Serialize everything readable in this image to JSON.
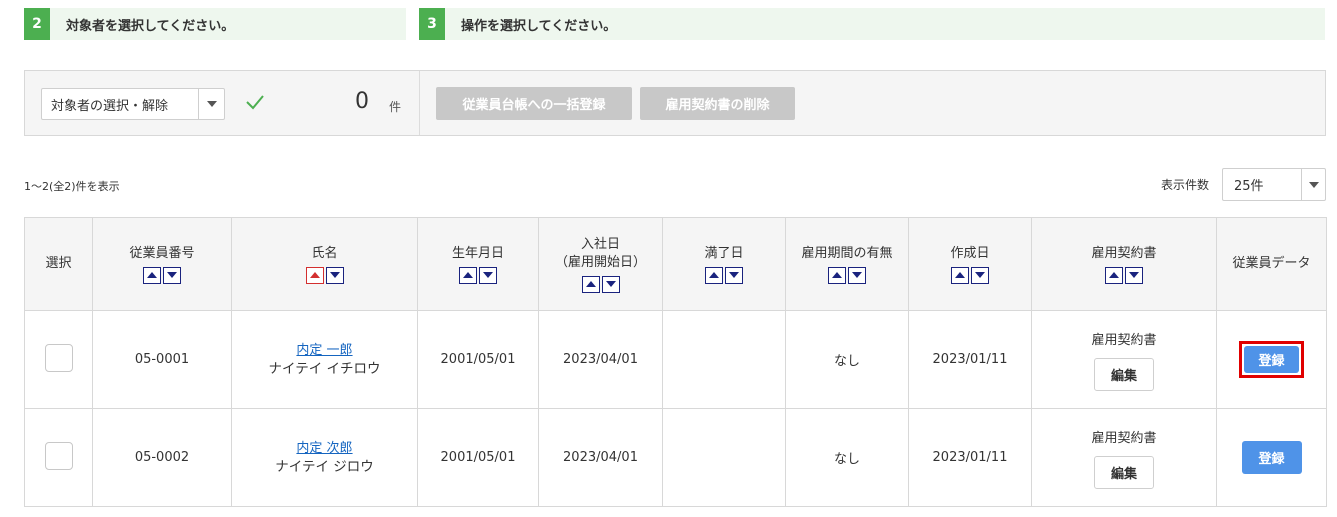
{
  "steps": [
    {
      "number": "2",
      "label": "対象者を選択してください。"
    },
    {
      "number": "3",
      "label": "操作を選択してください。"
    }
  ],
  "actions": {
    "target_select_label": "対象者の選択・解除",
    "selected_count": "0",
    "count_unit": "件",
    "bulk_register_label": "従業員台帳への一括登録",
    "delete_contract_label": "雇用契約書の削除"
  },
  "results": {
    "summary": "1〜2(全2)件を表示",
    "per_page_label": "表示件数",
    "per_page_value": "25件"
  },
  "table": {
    "headers": {
      "select": "選択",
      "employee_no": "従業員番号",
      "name": "氏名",
      "birthdate": "生年月日",
      "hire_date_1": "入社日",
      "hire_date_2": "（雇用開始日）",
      "end_date": "満了日",
      "term": "雇用期間の有無",
      "created": "作成日",
      "contract": "雇用契約書",
      "employee_data": "従業員データ"
    },
    "rows": [
      {
        "employee_no": "05-0001",
        "name": "内定 一郎",
        "kana": "ナイテイ イチロウ",
        "birthdate": "2001/05/01",
        "hire_date": "2023/04/01",
        "end_date": "",
        "term": "なし",
        "created": "2023/01/11",
        "contract_label": "雇用契約書",
        "edit_label": "編集",
        "register_label": "登録"
      },
      {
        "employee_no": "05-0002",
        "name": "内定 次郎",
        "kana": "ナイテイ ジロウ",
        "birthdate": "2001/05/01",
        "hire_date": "2023/04/01",
        "end_date": "",
        "term": "なし",
        "created": "2023/01/11",
        "contract_label": "雇用契約書",
        "edit_label": "編集",
        "register_label": "登録"
      }
    ]
  },
  "colors": {
    "step_accent": "#4caf50",
    "register_button": "#4f93e8",
    "highlight_border": "#e00000",
    "link": "#1565c0"
  }
}
